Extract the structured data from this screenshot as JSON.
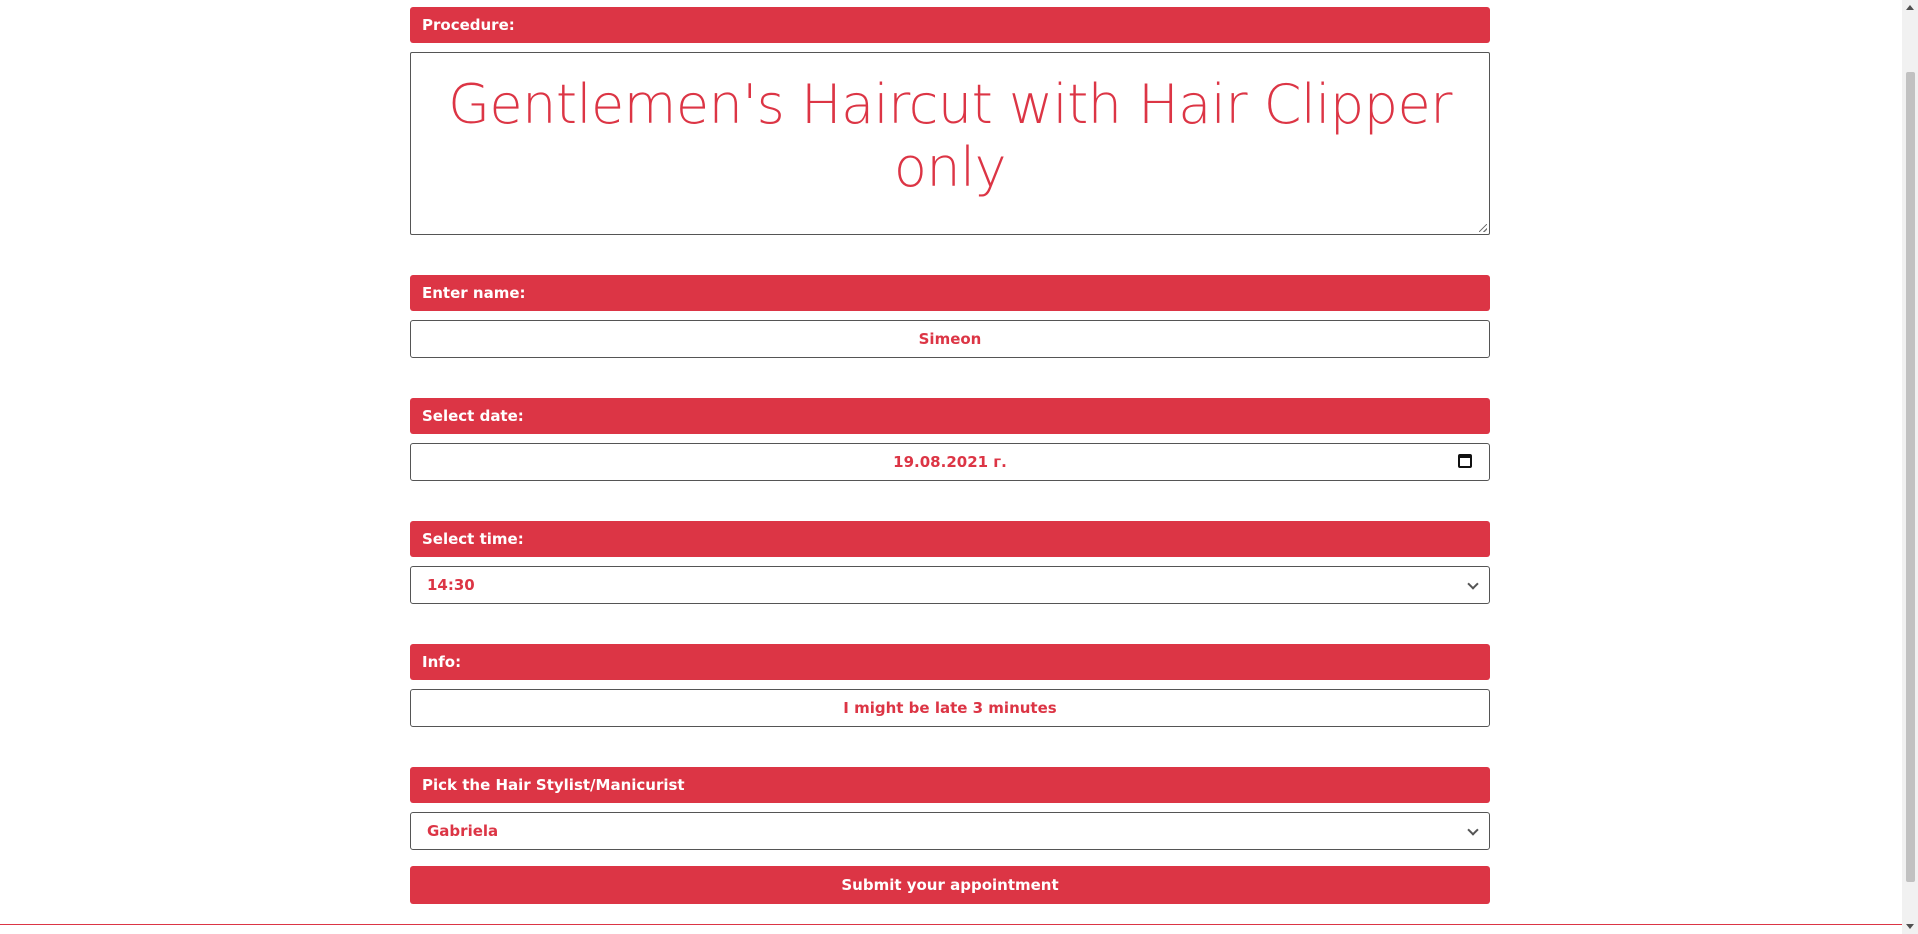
{
  "form": {
    "procedure_label": "Procedure:",
    "procedure_value": "Gentlemen's Haircut with Hair Clipper only",
    "name_label": "Enter name:",
    "name_value": "Simeon",
    "date_label": "Select date:",
    "date_value": "19.08.2021 г.",
    "time_label": "Select time:",
    "time_value": "14:30",
    "info_label": "Info:",
    "info_value": "I might be late 3 minutes",
    "stylist_label": "Pick the Hair Stylist/Manicurist",
    "stylist_value": "Gabriela",
    "submit_label": "Submit your appointment"
  },
  "colors": {
    "accent": "#dc3545",
    "background": "#ffffff"
  },
  "icons": [
    "calendar-icon",
    "chevron-down-icon",
    "resize-handle-icon"
  ]
}
